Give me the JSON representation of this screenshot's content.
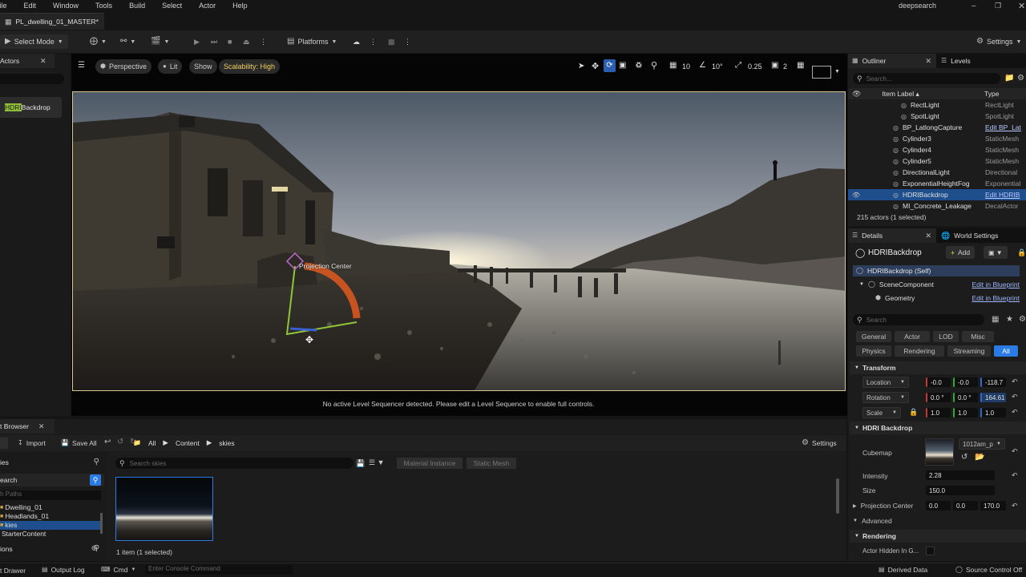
{
  "menubar": {
    "items": [
      "File",
      "Edit",
      "Window",
      "Tools",
      "Build",
      "Select",
      "Actor",
      "Help"
    ],
    "app_search": "deepsearch"
  },
  "tab": {
    "title": "PL_dwelling_01_MASTER*"
  },
  "toolbar": {
    "select_mode": "Select Mode",
    "platforms": "Platforms",
    "settings": "Settings"
  },
  "left_panel": {
    "title": "Actors",
    "item": "HDRIBackdrop",
    "highlight": "HDRI"
  },
  "viewport": {
    "perspective": "Perspective",
    "lit": "Lit",
    "show": "Show",
    "scalability": "Scalability: High",
    "grid_snap": "10",
    "angle_snap": "10°",
    "scale_snap": "0.25",
    "camera_speed": "2",
    "gizmo_label": "Projection Center",
    "sequencer_msg": "No active Level Sequencer detected. Please edit a Level Sequence to enable full controls."
  },
  "outliner": {
    "tab_outliner": "Outliner",
    "tab_levels": "Levels",
    "search_placeholder": "Search...",
    "col_label": "Item Label ▴",
    "col_type": "Type",
    "rows": [
      {
        "label": "RectLight",
        "type": "RectLight",
        "indent": 2
      },
      {
        "label": "SpotLight",
        "type": "SpotLight",
        "indent": 2
      },
      {
        "label": "BP_LatlongCapture",
        "type": "Edit BP_Lat",
        "indent": 1,
        "link": true
      },
      {
        "label": "Cylinder3",
        "type": "StaticMesh",
        "indent": 1
      },
      {
        "label": "Cylinder4",
        "type": "StaticMesh",
        "indent": 1
      },
      {
        "label": "Cylinder5",
        "type": "StaticMesh",
        "indent": 1
      },
      {
        "label": "DirectionalLight",
        "type": "Directional",
        "indent": 1
      },
      {
        "label": "ExponentialHeightFog",
        "type": "Exponential",
        "indent": 1
      },
      {
        "label": "HDRIBackdrop",
        "type": "Edit HDRIB",
        "indent": 1,
        "link": true,
        "selected": true
      },
      {
        "label": "MI_Concrete_Leakage",
        "type": "DecalActor",
        "indent": 1
      }
    ],
    "status": "215 actors (1 selected)"
  },
  "details": {
    "tab_details": "Details",
    "tab_world": "World Settings",
    "actor_name": "HDRIBackdrop",
    "add_label": "Add",
    "components": [
      {
        "label": "HDRIBackdrop (Self)",
        "link": ""
      },
      {
        "label": "SceneComponent",
        "link": "Edit in Blueprint"
      },
      {
        "label": "Geometry",
        "link": "Edit in Blueprint"
      }
    ],
    "search_placeholder": "Search",
    "filters_row1": [
      "General",
      "Actor",
      "LOD",
      "Misc"
    ],
    "filters_row2": [
      "Physics",
      "Rendering",
      "Streaming",
      "All"
    ],
    "transform_title": "Transform",
    "location": {
      "label": "Location",
      "x": "-0.0",
      "y": "-0.0",
      "z": "-118.7"
    },
    "rotation": {
      "label": "Rotation",
      "x": "0.0 °",
      "y": "0.0 °",
      "z": "164.61"
    },
    "scale": {
      "label": "Scale",
      "x": "1.0",
      "y": "1.0",
      "z": "1.0"
    },
    "hdri_title": "HDRI Backdrop",
    "cubemap_label": "Cubemap",
    "cubemap_value": "1012am_p",
    "intensity_label": "Intensity",
    "intensity_value": "2.28",
    "size_label": "Size",
    "size_value": "150.0",
    "projection_label": "Projection Center",
    "projection": {
      "x": "0.0",
      "y": "0.0",
      "z": "170.0"
    },
    "advanced_label": "Advanced",
    "rendering_title": "Rendering",
    "hidden_label": "Actor Hidden In G..."
  },
  "content_browser": {
    "tab": "t Browser",
    "import": "Import",
    "save_all": "Save All",
    "path": [
      "All",
      "Content",
      "skies"
    ],
    "settings": "Settings",
    "search_placeholder": "Search skies",
    "filter_chips": [
      "Material Instance",
      "Static Mesh"
    ],
    "left_header": "ies",
    "left_search": "earch",
    "paths_placeholder": "h Paths",
    "folders": [
      "Dwelling_01",
      "Headlands_01",
      "kies",
      "StarterContent"
    ],
    "collections": "ions",
    "status": "1 item (1 selected)"
  },
  "statusbar": {
    "drawer": "t Drawer",
    "output_log": "Output Log",
    "cmd": "Cmd",
    "console_placeholder": "Enter Console Command",
    "derived_data": "Derived Data",
    "source_control": "Source Control Off"
  },
  "colors": {
    "accent": "#2a7be4",
    "selection": "#1e4e8c",
    "gizmo_red": "#e05a1f",
    "gizmo_green": "#8fc63a",
    "gizmo_blue": "#3a5fd0"
  }
}
